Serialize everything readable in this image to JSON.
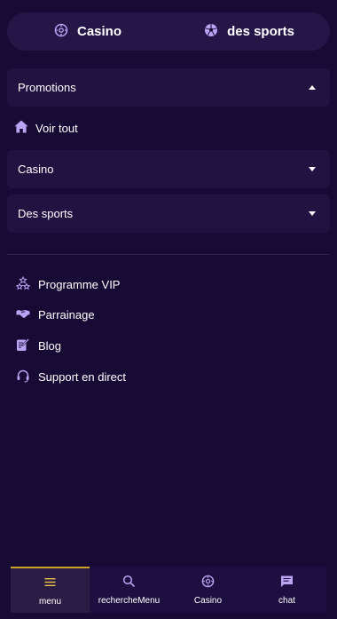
{
  "top_switch": {
    "casino_label": "Casino",
    "sports_label": "des sports"
  },
  "menu": {
    "promotions_label": "Promotions",
    "voir_tout_label": "Voir tout",
    "casino_label": "Casino",
    "sports_label": "Des sports"
  },
  "links": {
    "vip_label": "Programme VIP",
    "referral_label": "Parrainage",
    "blog_label": "Blog",
    "support_label": "Support en direct"
  },
  "bottom_nav": {
    "menu_label": "menu",
    "search_label": "rechercheMenu",
    "casino_label": "Casino",
    "chat_label": "chat"
  },
  "colors": {
    "background": "#170b36",
    "panel": "#211242",
    "accent_icon": "#b9a3f2",
    "active_gold": "#c9a227"
  },
  "icons": {
    "casino": "roulette-icon",
    "sports": "soccer-ball-icon",
    "home": "home-icon",
    "vip": "stars-icon",
    "referral": "handshake-icon",
    "blog": "edit-icon",
    "support": "headset-icon",
    "menu": "menu-icon",
    "search": "search-icon",
    "chat": "chat-icon"
  }
}
